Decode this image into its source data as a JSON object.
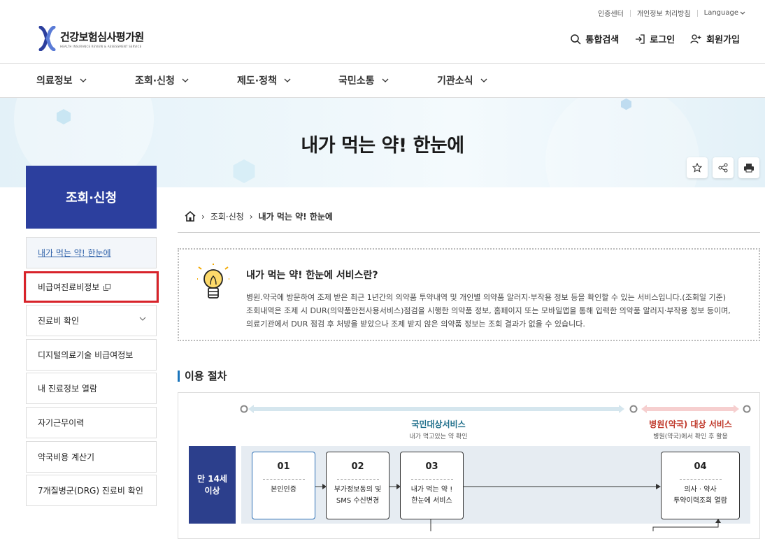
{
  "util": {
    "cert_center": "인증센터",
    "privacy": "개인정보 처리방침",
    "language": "Language"
  },
  "logo": {
    "name": "건강보험심사평가원",
    "sub": "HEALTH INSURANCE REVIEW & ASSESSMENT SERVICE"
  },
  "header": {
    "search": "통합검색",
    "login": "로그인",
    "signup": "회원가입"
  },
  "gnb": [
    "의료정보",
    "조회·신청",
    "제도·정책",
    "국민소통",
    "기관소식"
  ],
  "page_title": "내가 먹는 약! 한눈에",
  "tools": [
    "star-icon",
    "share-icon",
    "print-icon"
  ],
  "sidebar": {
    "title": "조회·신청",
    "items": [
      {
        "label": "내가 먹는 약! 한눈에"
      },
      {
        "label": "비급여진료비정보"
      },
      {
        "label": "진료비 확인"
      },
      {
        "label": "디지털의료기술 비급여정보"
      },
      {
        "label": "내 진료정보 열람"
      },
      {
        "label": "자기근무이력"
      },
      {
        "label": "약국비용 계산기"
      },
      {
        "label": "7개질병군(DRG) 진료비 확인"
      }
    ]
  },
  "breadcrumb": {
    "level1": "조회·신청",
    "current": "내가 먹는 약! 한눈에"
  },
  "info": {
    "title": "내가 먹는 약! 한눈에 서비스란?",
    "line1": "병원.약국에 방문하여 조제 받은 최근 1년간의 의약품 투약내역 및 개인별 의약품 알러지·부작용 정보 등을 확인할 수 있는 서비스입니다.(조회일 기준)",
    "line2": "조회내역은 조제 시 DUR(의약품안전사용서비스)점검을 시행한 의약품 정보, 홈페이지 또는 모바일앱을 통해 입력한 의약품 알러지·부작용 정보 등이며,",
    "line3": "의료기관에서 DUR 점검 후 처방을 받았으나 조제 받지 않은 의약품 정보는 조회 결과가 없을 수 있습니다."
  },
  "procedure": {
    "title": "이용 절차",
    "lane1": {
      "label": "국민대상서비스",
      "sub": "내가 먹고있는 약 확인"
    },
    "lane2": {
      "label": "병원(약국) 대상 서비스",
      "sub": "병원(약국)에서 확인 후 활용"
    },
    "age": [
      "만 14세",
      "이상"
    ],
    "steps": [
      {
        "num": "01",
        "line1": "본인인증",
        "line2": ""
      },
      {
        "num": "02",
        "line1": "부가정보동의 및",
        "line2": "SMS 수신변경"
      },
      {
        "num": "03",
        "line1": "내가 먹는 약 !",
        "line2": "한눈에 서비스"
      },
      {
        "num": "04",
        "line1": "의사 · 약사",
        "line2": "투약이력조회 열람"
      }
    ],
    "colors": {
      "lane1": "#1f6f8b",
      "lane2": "#c0392b",
      "age_bg": "#2c3f8c"
    }
  }
}
